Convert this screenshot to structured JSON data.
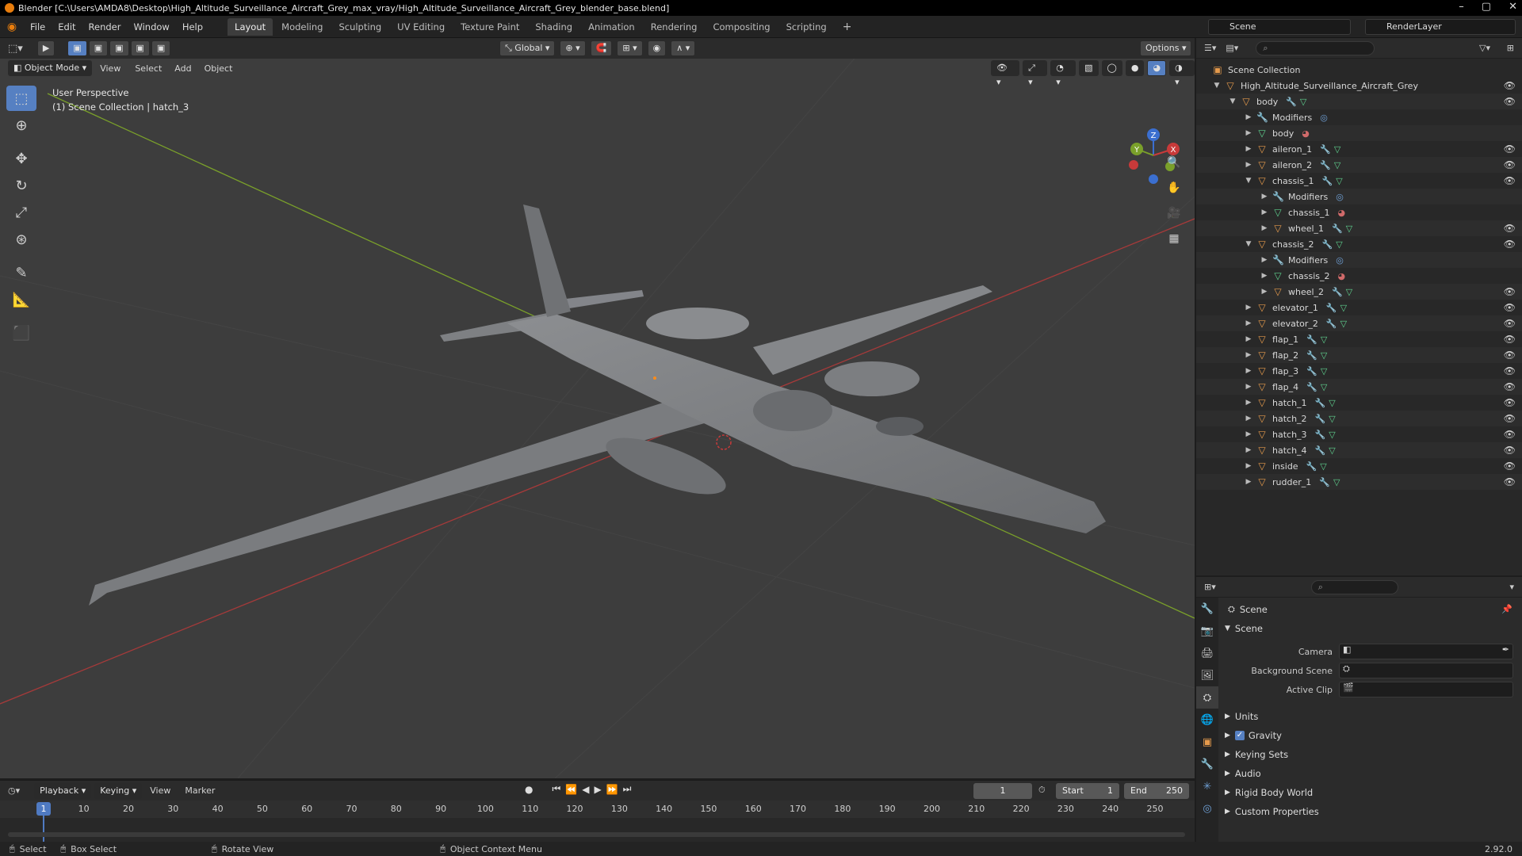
{
  "title_bar": {
    "text": "Blender [C:\\Users\\AMDA8\\Desktop\\High_Altitude_Surveillance_Aircraft_Grey_max_vray/High_Altitude_Surveillance_Aircraft_Grey_blender_base.blend]"
  },
  "menu": [
    "File",
    "Edit",
    "Render",
    "Window",
    "Help"
  ],
  "workspaces": [
    "Layout",
    "Modeling",
    "Sculpting",
    "UV Editing",
    "Texture Paint",
    "Shading",
    "Animation",
    "Rendering",
    "Compositing",
    "Scripting"
  ],
  "active_workspace": "Layout",
  "scene_name": "Scene",
  "render_layer": "RenderLayer",
  "viewport": {
    "mode": "Object Mode",
    "menus": [
      "View",
      "Select",
      "Add",
      "Object"
    ],
    "orientation": "Global",
    "options_label": "Options",
    "info_line1": "User Perspective",
    "info_line2": "(1) Scene Collection | hatch_3",
    "gizmo_axes": {
      "x": "X",
      "y": "Y",
      "z": "Z"
    },
    "colors": {
      "bg": "#3d3d3d",
      "x_axis": "#a63a3a",
      "y_axis": "#7aa02a",
      "plane": "#8b8d90"
    }
  },
  "outliner": {
    "root": "Scene Collection",
    "items": [
      {
        "label": "High_Altitude_Surveillance_Aircraft_Grey",
        "depth": 0,
        "type": "obj",
        "expanded": true,
        "eye": true
      },
      {
        "label": "body",
        "depth": 1,
        "type": "obj",
        "expanded": true,
        "eye": true
      },
      {
        "label": "Modifiers",
        "depth": 2,
        "type": "mod",
        "expanded": false,
        "eye": false
      },
      {
        "label": "body",
        "depth": 2,
        "type": "mesh",
        "expanded": false,
        "eye": false
      },
      {
        "label": "aileron_1",
        "depth": 2,
        "type": "obj",
        "expanded": false,
        "eye": true
      },
      {
        "label": "aileron_2",
        "depth": 2,
        "type": "obj",
        "expanded": false,
        "eye": true
      },
      {
        "label": "chassis_1",
        "depth": 2,
        "type": "obj",
        "expanded": true,
        "eye": true
      },
      {
        "label": "Modifiers",
        "depth": 3,
        "type": "mod",
        "expanded": false,
        "eye": false
      },
      {
        "label": "chassis_1",
        "depth": 3,
        "type": "mesh",
        "expanded": false,
        "eye": false
      },
      {
        "label": "wheel_1",
        "depth": 3,
        "type": "obj",
        "expanded": false,
        "eye": true
      },
      {
        "label": "chassis_2",
        "depth": 2,
        "type": "obj",
        "expanded": true,
        "eye": true
      },
      {
        "label": "Modifiers",
        "depth": 3,
        "type": "mod",
        "expanded": false,
        "eye": false
      },
      {
        "label": "chassis_2",
        "depth": 3,
        "type": "mesh",
        "expanded": false,
        "eye": false
      },
      {
        "label": "wheel_2",
        "depth": 3,
        "type": "obj",
        "expanded": false,
        "eye": true
      },
      {
        "label": "elevator_1",
        "depth": 2,
        "type": "obj",
        "expanded": false,
        "eye": true
      },
      {
        "label": "elevator_2",
        "depth": 2,
        "type": "obj",
        "expanded": false,
        "eye": true
      },
      {
        "label": "flap_1",
        "depth": 2,
        "type": "obj",
        "expanded": false,
        "eye": true
      },
      {
        "label": "flap_2",
        "depth": 2,
        "type": "obj",
        "expanded": false,
        "eye": true
      },
      {
        "label": "flap_3",
        "depth": 2,
        "type": "obj",
        "expanded": false,
        "eye": true
      },
      {
        "label": "flap_4",
        "depth": 2,
        "type": "obj",
        "expanded": false,
        "eye": true
      },
      {
        "label": "hatch_1",
        "depth": 2,
        "type": "obj",
        "expanded": false,
        "eye": true
      },
      {
        "label": "hatch_2",
        "depth": 2,
        "type": "obj",
        "expanded": false,
        "eye": true
      },
      {
        "label": "hatch_3",
        "depth": 2,
        "type": "obj",
        "expanded": false,
        "eye": true
      },
      {
        "label": "hatch_4",
        "depth": 2,
        "type": "obj",
        "expanded": false,
        "eye": true
      },
      {
        "label": "inside",
        "depth": 2,
        "type": "obj",
        "expanded": false,
        "eye": true
      },
      {
        "label": "rudder_1",
        "depth": 2,
        "type": "obj",
        "expanded": false,
        "eye": true
      }
    ]
  },
  "properties": {
    "header": "Scene",
    "section": "Scene",
    "fields": [
      {
        "label": "Camera"
      },
      {
        "label": "Background Scene"
      },
      {
        "label": "Active Clip"
      }
    ],
    "panels": [
      "Units",
      "Gravity",
      "Keying Sets",
      "Audio",
      "Rigid Body World",
      "Custom Properties"
    ],
    "gravity_checked": true
  },
  "timeline": {
    "menus": [
      "Playback",
      "Keying",
      "View",
      "Marker"
    ],
    "current_frame": "1",
    "start_label": "Start",
    "start": "1",
    "end_label": "End",
    "end": "250",
    "ticks": [
      "1",
      "10",
      "20",
      "30",
      "40",
      "50",
      "60",
      "70",
      "80",
      "90",
      "100",
      "110",
      "120",
      "130",
      "140",
      "150",
      "160",
      "170",
      "180",
      "190",
      "200",
      "210",
      "220",
      "230",
      "240",
      "250"
    ]
  },
  "status": {
    "select": "Select",
    "box_select": "Box Select",
    "rotate": "Rotate View",
    "context": "Object Context Menu",
    "version": "2.92.0"
  }
}
